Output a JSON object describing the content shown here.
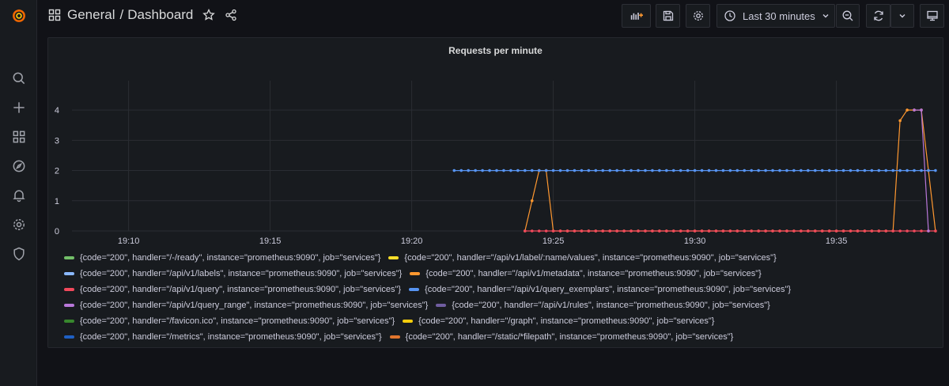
{
  "breadcrumb": {
    "folder": "General",
    "separator": "/",
    "dashboard": "Dashboard"
  },
  "toolbar": {
    "time_range": "Last 30 minutes"
  },
  "panel": {
    "title": "Requests per minute"
  },
  "colors": {
    "accent_orange": "#ff9830",
    "grafana_logo": "#f46800"
  },
  "chart_data": {
    "type": "line",
    "title": "Requests per minute",
    "xlabel": "",
    "ylabel": "",
    "x_ticks": [
      "19:10",
      "19:15",
      "19:20",
      "19:25",
      "19:30",
      "19:35"
    ],
    "x_range": [
      "19:08",
      "19:38"
    ],
    "y_ticks": [
      0,
      1,
      2,
      3,
      4
    ],
    "ylim": [
      0,
      4.5
    ],
    "grid": true,
    "legend_position": "bottom",
    "series": [
      {
        "name": "{code=\"200\", handler=\"/-/ready\", instance=\"prometheus:9090\", job=\"services\"}",
        "color": "#73bf69",
        "points": []
      },
      {
        "name": "{code=\"200\", handler=\"/api/v1/label/:name/values\", instance=\"prometheus:9090\", job=\"services\"}",
        "color": "#fade2a",
        "points": []
      },
      {
        "name": "{code=\"200\", handler=\"/api/v1/labels\", instance=\"prometheus:9090\", job=\"services\"}",
        "color": "#8ab8ff",
        "points": []
      },
      {
        "name": "{code=\"200\", handler=\"/api/v1/metadata\", instance=\"prometheus:9090\", job=\"services\"}",
        "color": "#ff9830",
        "points": [
          [
            "19:24",
            0
          ],
          [
            "19:24.5",
            2
          ],
          [
            "19:24.75",
            2
          ],
          [
            "19:25",
            0
          ],
          [
            "19:37",
            0
          ],
          [
            "19:37.25",
            3.65
          ],
          [
            "19:37.5",
            4
          ],
          [
            "19:37.75",
            4
          ],
          [
            "19:38",
            4
          ],
          [
            "19:38.25",
            2
          ],
          [
            "19:38.5",
            0
          ]
        ]
      },
      {
        "name": "{code=\"200\", handler=\"/api/v1/query\", instance=\"prometheus:9090\", job=\"services\"}",
        "color": "#f2495c",
        "points": [
          [
            "19:24",
            0
          ],
          [
            "19:38.5",
            0
          ]
        ]
      },
      {
        "name": "{code=\"200\", handler=\"/api/v1/query_exemplars\", instance=\"prometheus:9090\", job=\"services\"}",
        "color": "#5794f2",
        "points": [
          [
            "19:21.5",
            2
          ],
          [
            "19:38.5",
            2
          ]
        ]
      },
      {
        "name": "{code=\"200\", handler=\"/api/v1/query_range\", instance=\"prometheus:9090\", job=\"services\"}",
        "color": "#b877d9",
        "points": [
          [
            "19:37.75",
            4
          ],
          [
            "19:38",
            4
          ],
          [
            "19:38.25",
            0
          ]
        ]
      },
      {
        "name": "{code=\"200\", handler=\"/api/v1/rules\", instance=\"prometheus:9090\", job=\"services\"}",
        "color": "#705da0",
        "points": []
      },
      {
        "name": "{code=\"200\", handler=\"/favicon.ico\", instance=\"prometheus:9090\", job=\"services\"}",
        "color": "#37872d",
        "points": []
      },
      {
        "name": "{code=\"200\", handler=\"/graph\", instance=\"prometheus:9090\", job=\"services\"}",
        "color": "#f2cc0c",
        "points": []
      },
      {
        "name": "{code=\"200\", handler=\"/metrics\", instance=\"prometheus:9090\", job=\"services\"}",
        "color": "#1f60c4",
        "points": []
      },
      {
        "name": "{code=\"200\", handler=\"/static/*filepath\", instance=\"prometheus:9090\", job=\"services\"}",
        "color": "#e0752d",
        "points": []
      }
    ]
  }
}
